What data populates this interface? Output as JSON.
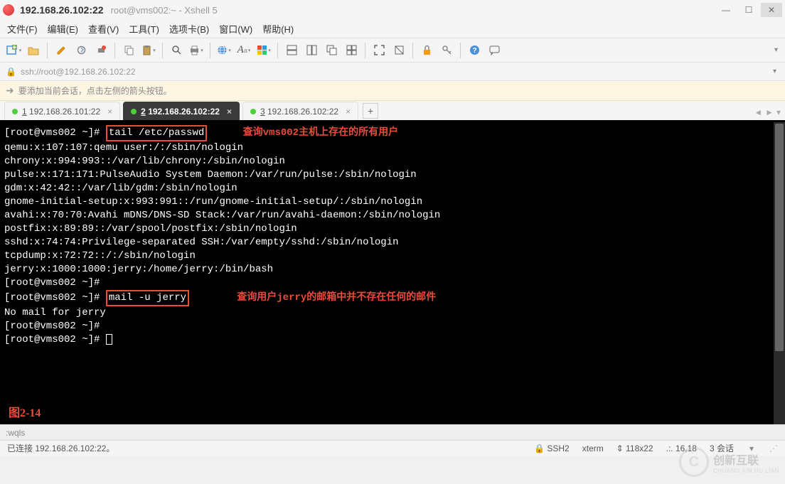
{
  "window": {
    "title_bold": "192.168.26.102:22",
    "title_sub": "root@vms002:~ - Xshell 5"
  },
  "menu": {
    "file": "文件(F)",
    "edit": "编辑(E)",
    "view": "查看(V)",
    "tools": "工具(T)",
    "tabs": "选项卡(B)",
    "window": "窗口(W)",
    "help": "帮助(H)"
  },
  "toolbar_icons": {
    "new": "new-session",
    "open": "open",
    "edit": "edit-pencil",
    "props": "properties",
    "copy": "copy",
    "paste": "paste",
    "find": "find",
    "print": "print",
    "globe": "globe",
    "font": "font",
    "palette": "color",
    "tile1": "tile-horiz",
    "tile2": "tile-vert",
    "tile3": "tile-cascade",
    "tile4": "tile-grid",
    "full": "fullscreen",
    "lock": "lock",
    "key": "key",
    "help": "help",
    "chat": "chat"
  },
  "address": "ssh://root@192.168.26.102:22",
  "hint": "要添加当前会话，点击左侧的箭头按钮。",
  "tabs": [
    {
      "num": "1",
      "label": "192.168.26.101:22",
      "active": false
    },
    {
      "num": "2",
      "label": "192.168.26.102:22",
      "active": true
    },
    {
      "num": "3",
      "label": "192.168.26.102:22",
      "active": false
    }
  ],
  "terminal": {
    "prompt": "[root@vms002 ~]#",
    "cmd1": "tail /etc/passwd",
    "ann1": "查询vms002主机上存在的所有用户",
    "lines": [
      "qemu:x:107:107:qemu user:/:/sbin/nologin",
      "chrony:x:994:993::/var/lib/chrony:/sbin/nologin",
      "pulse:x:171:171:PulseAudio System Daemon:/var/run/pulse:/sbin/nologin",
      "gdm:x:42:42::/var/lib/gdm:/sbin/nologin",
      "gnome-initial-setup:x:993:991::/run/gnome-initial-setup/:/sbin/nologin",
      "avahi:x:70:70:Avahi mDNS/DNS-SD Stack:/var/run/avahi-daemon:/sbin/nologin",
      "postfix:x:89:89::/var/spool/postfix:/sbin/nologin",
      "sshd:x:74:74:Privilege-separated SSH:/var/empty/sshd:/sbin/nologin",
      "tcpdump:x:72:72::/:/sbin/nologin",
      "jerry:x:1000:1000:jerry:/home/jerry:/bin/bash"
    ],
    "cmd2": "mail -u jerry",
    "ann2": "查询用户jerry的邮箱中并不存在任何的邮件",
    "out2": "No mail for jerry",
    "fig": "图2-14"
  },
  "cmdline": ":wqls",
  "status": {
    "conn": "已连接 192.168.26.102:22。",
    "proto": "SSH2",
    "term": "xterm",
    "size": "118x22",
    "pos": "16,18",
    "sess": "3 会话"
  },
  "watermark": {
    "cn": "创新互联",
    "en": "CHUANG XIN HU LIAN"
  }
}
